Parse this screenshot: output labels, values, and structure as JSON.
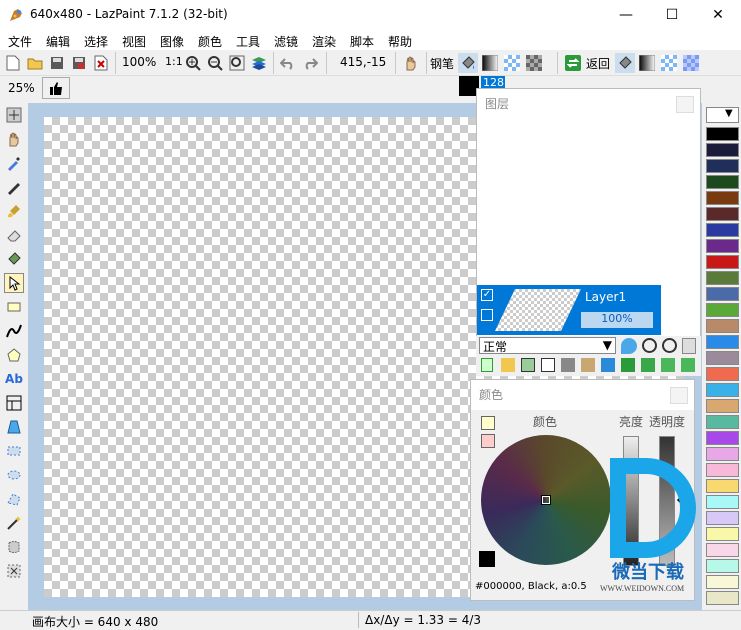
{
  "window": {
    "title": "640x480 - LazPaint 7.1.2 (32-bit)",
    "minimize": "—",
    "maximize": "☐",
    "close": "✕"
  },
  "menu": [
    "文件",
    "编辑",
    "选择",
    "视图",
    "图像",
    "颜色",
    "工具",
    "滤镜",
    "渲染",
    "脚本",
    "帮助"
  ],
  "toolbar": {
    "zoom": "100%",
    "ratio": "1:1",
    "coords": "415,-15",
    "tool_label": "钢笔",
    "back_label": "返回",
    "pen_width": "128"
  },
  "toolbar2": {
    "zoom": "25%"
  },
  "layers_panel": {
    "title": "图层",
    "layer_name": "Layer1",
    "opacity": "100%",
    "blend_mode": "正常"
  },
  "color_panel": {
    "title": "颜色",
    "color_label": "颜色",
    "brightness_label": "亮度",
    "alpha_label": "透明度",
    "color_value": "#000000, Black, a:0.5"
  },
  "status": {
    "canvas_size": "画布大小 = 640 x 480",
    "ratio": "Δx/Δy = 1.33 = 4/3"
  },
  "watermark": {
    "text": "微当下载",
    "url": "WWW.WEIDOWN.COM"
  },
  "colors": {
    "accent": "#0078d7",
    "canvas_bg": "#b3cce3",
    "layer_selected": "#0078d7"
  },
  "palette": [
    "#000000",
    "#1b1b3a",
    "#1f2f5a",
    "#1c4a1c",
    "#7a3a10",
    "#5a2a2a",
    "#2a3aa0",
    "#6b2a8a",
    "#c81818",
    "#5a7a3a",
    "#4a6aa8",
    "#5aa838",
    "#b88a6a",
    "#2a8ae8",
    "#9a8a9a",
    "#f06a50",
    "#3ab0e8",
    "#d8a870",
    "#58b8a0",
    "#a848e8",
    "#e8a8e8",
    "#f8b8d8",
    "#f8d870",
    "#a8f8f8",
    "#d8c8f8",
    "#f8f8a8",
    "#f8d8e8",
    "#b8f8e8",
    "#f8f8d8",
    "#e8e8c8"
  ]
}
